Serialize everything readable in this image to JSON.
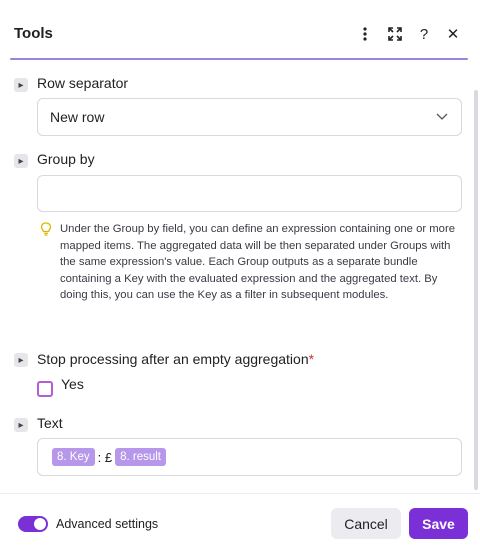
{
  "header": {
    "title": "Tools",
    "icons": [
      "more-vertical-icon",
      "fullscreen-icon",
      "help-icon",
      "close-icon"
    ],
    "help_glyph": "?",
    "close_glyph": "✕",
    "accent_color": "#9b84d9"
  },
  "fields": {
    "row_separator": {
      "label": "Row separator",
      "value": "New row"
    },
    "group_by": {
      "label": "Group by",
      "value": "",
      "hint": "Under the Group by field, you can define an expression containing one or more mapped items. The aggregated data will be then separated under Groups with the same expression's value. Each Group outputs as a separate bundle containing a Key with the evaluated expression and the aggregated text. By doing this, you can use the Key as a filter in subsequent modules."
    },
    "stop_processing": {
      "label": "Stop processing after an empty aggregation",
      "required_mark": "*",
      "option_label": "Yes",
      "checked": false
    },
    "text": {
      "label": "Text",
      "token1": "8. Key",
      "separator": ": £",
      "token2": "8. result"
    }
  },
  "footer": {
    "advanced_label": "Advanced settings",
    "advanced_enabled": true,
    "cancel_label": "Cancel",
    "save_label": "Save",
    "primary_color": "#7b2fd6"
  }
}
